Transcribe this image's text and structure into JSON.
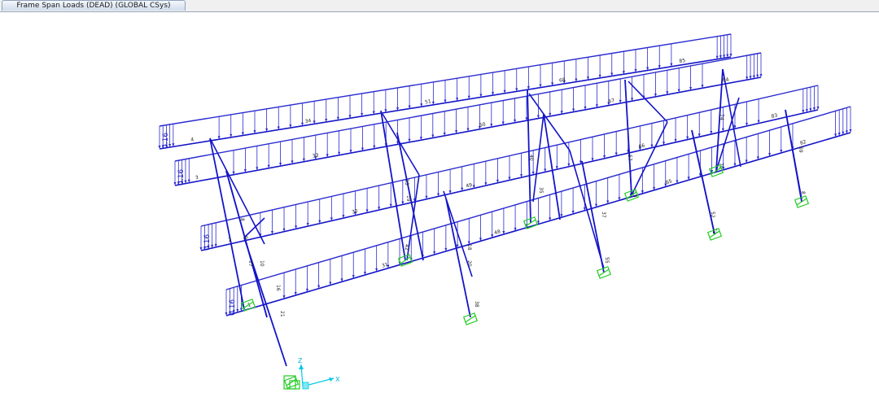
{
  "window": {
    "tab_title": "Frame Span Loads (DEAD) (GLOBAL CSys)"
  },
  "theme": {
    "frame_color": "#1414c8",
    "load_color": "#2a2ad0",
    "support_color": "#22cc22",
    "axis_color": "#00c8e8",
    "label_color": "#202020"
  },
  "load_value": "0.16",
  "axes": {
    "x": "X",
    "z": "Z"
  },
  "frames": {
    "r1": [
      "4",
      "34",
      "51",
      "68",
      "85"
    ],
    "r2": [
      "3",
      "33",
      "50",
      "67",
      "84"
    ],
    "r3": [
      "2",
      "32",
      "49",
      "66",
      "83"
    ],
    "r4": [
      "1",
      "31",
      "48",
      "65",
      "82"
    ],
    "cols": [
      "8",
      "9",
      "17",
      "10",
      "16",
      "21",
      "23",
      "19",
      "18",
      "20",
      "38",
      "42",
      "40",
      "35",
      "37",
      "55",
      "57",
      "53",
      "52",
      "72",
      "74",
      "70",
      "69"
    ]
  },
  "icons": [
    "pin-support-icon",
    "axis-triad-icon"
  ]
}
